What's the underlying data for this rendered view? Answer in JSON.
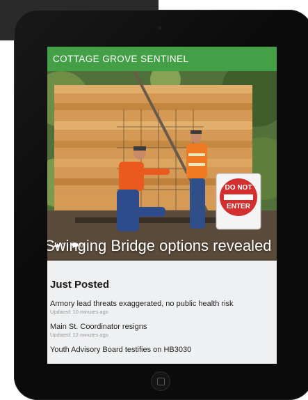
{
  "app": {
    "masthead_title": "COTTAGE GROVE SENTINEL"
  },
  "hero": {
    "headline": "Swinging Bridge options revealed",
    "sign_line1": "DO NOT",
    "sign_line2": "ENTER",
    "shares": "0",
    "comments": "0"
  },
  "just_posted": {
    "title": "Just Posted",
    "stories": [
      {
        "headline": "Armory lead threats exaggerated, no public health risk",
        "updated": "Updated: 10 minutes ago"
      },
      {
        "headline": "Main St. Coordinator resigns",
        "updated": "Updated: 12 minutes ago"
      },
      {
        "headline": "Youth Advisory Board testifies on HB3030",
        "updated": ""
      }
    ]
  },
  "colors": {
    "masthead": "#43a047",
    "bezel": "#0b0b0b",
    "sign_red": "#d32f2f"
  },
  "icons": [
    "share-icon",
    "comment-icon",
    "home-button-icon"
  ]
}
